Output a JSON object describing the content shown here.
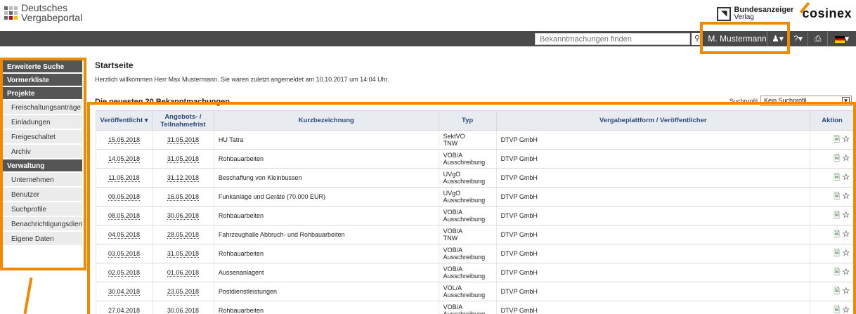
{
  "header": {
    "logo_line1": "Deutsches",
    "logo_line2": "Vergabeportal",
    "partner1_line1": "Bundesanzeiger",
    "partner1_line2": "Verlag",
    "partner2": "cosinex"
  },
  "topbar": {
    "search_placeholder": "Bekanntmachungen finden",
    "user": "M. Mustermann",
    "help": "?",
    "print_icon": "print-icon",
    "flag_icon": "german-flag-icon"
  },
  "sidebar": {
    "items": [
      {
        "label": "Erweiterte Suche",
        "type": "header"
      },
      {
        "label": "Vormerkliste",
        "type": "header"
      },
      {
        "label": "Projekte",
        "type": "header"
      },
      {
        "label": "Freischaltungsanträge",
        "type": "item"
      },
      {
        "label": "Einladungen",
        "type": "item"
      },
      {
        "label": "Freigeschaltet",
        "type": "item"
      },
      {
        "label": "Archiv",
        "type": "item"
      },
      {
        "label": "Verwaltung",
        "type": "header"
      },
      {
        "label": "Unternehmen",
        "type": "item"
      },
      {
        "label": "Benutzer",
        "type": "item"
      },
      {
        "label": "Suchprofile",
        "type": "item"
      },
      {
        "label": "Benachrichtigungsdienst",
        "type": "item"
      },
      {
        "label": "Eigene Daten",
        "type": "item"
      }
    ]
  },
  "main": {
    "title": "Startseite",
    "welcome": "Herzlich willkommen Herr Max Mustermann. Sie waren zuletzt angemeldet am 10.10.2017 um 14:04 Uhr.",
    "newest": "Die neuesten 20 Bekanntmachungen",
    "profile_label": "Suchprofil",
    "profile_value": "Kein Suchprofil"
  },
  "table": {
    "headers": {
      "published": "Veröffentlicht ▾",
      "deadline1": "Angebots- /",
      "deadline2": "Teilnahmefrist",
      "title": "Kurzbezeichnung",
      "type": "Typ",
      "platform": "Vergabeplattform / Veröffentlicher",
      "action": "Aktion"
    },
    "rows": [
      {
        "published": "15.05.2018",
        "deadline": "31.05.2018",
        "title": "HU Tatra",
        "type1": "SektVO",
        "type2": "TNW",
        "platform": "DTVP GmbH"
      },
      {
        "published": "14.05.2018",
        "deadline": "31.05.2018",
        "title": "Rohbauarbeiten",
        "type1": "VOB/A",
        "type2": "Ausschreibung",
        "platform": "DTVP GmbH"
      },
      {
        "published": "11.05.2018",
        "deadline": "31.12.2018",
        "title": "Beschaffung von Kleinbussen",
        "type1": "UVgO",
        "type2": "Ausschreibung",
        "platform": "DTVP GmbH"
      },
      {
        "published": "09.05.2018",
        "deadline": "16.05.2018",
        "title": "Funkanlage und Geräte (70.000 EUR)",
        "type1": "UVgO",
        "type2": "Ausschreibung",
        "platform": "DTVP GmbH"
      },
      {
        "published": "08.05.2018",
        "deadline": "30.06.2018",
        "title": "Rohbauarbeiten",
        "type1": "VOB/A",
        "type2": "Ausschreibung",
        "platform": "DTVP GmbH"
      },
      {
        "published": "04.05.2018",
        "deadline": "28.05.2018",
        "title": "Fahrzeughalle Abbruch- und Rohbauarbeiten",
        "type1": "VOB/A",
        "type2": "TNW",
        "platform": "DTVP GmbH"
      },
      {
        "published": "03.05.2018",
        "deadline": "31.05.2018",
        "title": "Rohbauarbeiten",
        "type1": "VOB/A",
        "type2": "Ausschreibung",
        "platform": "DTVP GmbH"
      },
      {
        "published": "02.05.2018",
        "deadline": "01.06.2018",
        "title": "Aussenanlagent",
        "type1": "VOB/A",
        "type2": "Ausschreibung",
        "platform": "DTVP GmbH"
      },
      {
        "published": "30.04.2018",
        "deadline": "23.05.2018",
        "title": "Postdienstleistungen",
        "type1": "VOL/A",
        "type2": "Ausschreibung",
        "platform": "DTVP GmbH"
      },
      {
        "published": "27.04.2018",
        "deadline": "30.06.2018",
        "title": "Rohbauarbeiten",
        "type1": "VOB/A",
        "type2": "Ausschreibung",
        "platform": "DTVP GmbH"
      }
    ]
  },
  "colors": {
    "highlight": "#f08a00",
    "topbar": "#4a4a4a",
    "sidebar_header": "#555555"
  }
}
